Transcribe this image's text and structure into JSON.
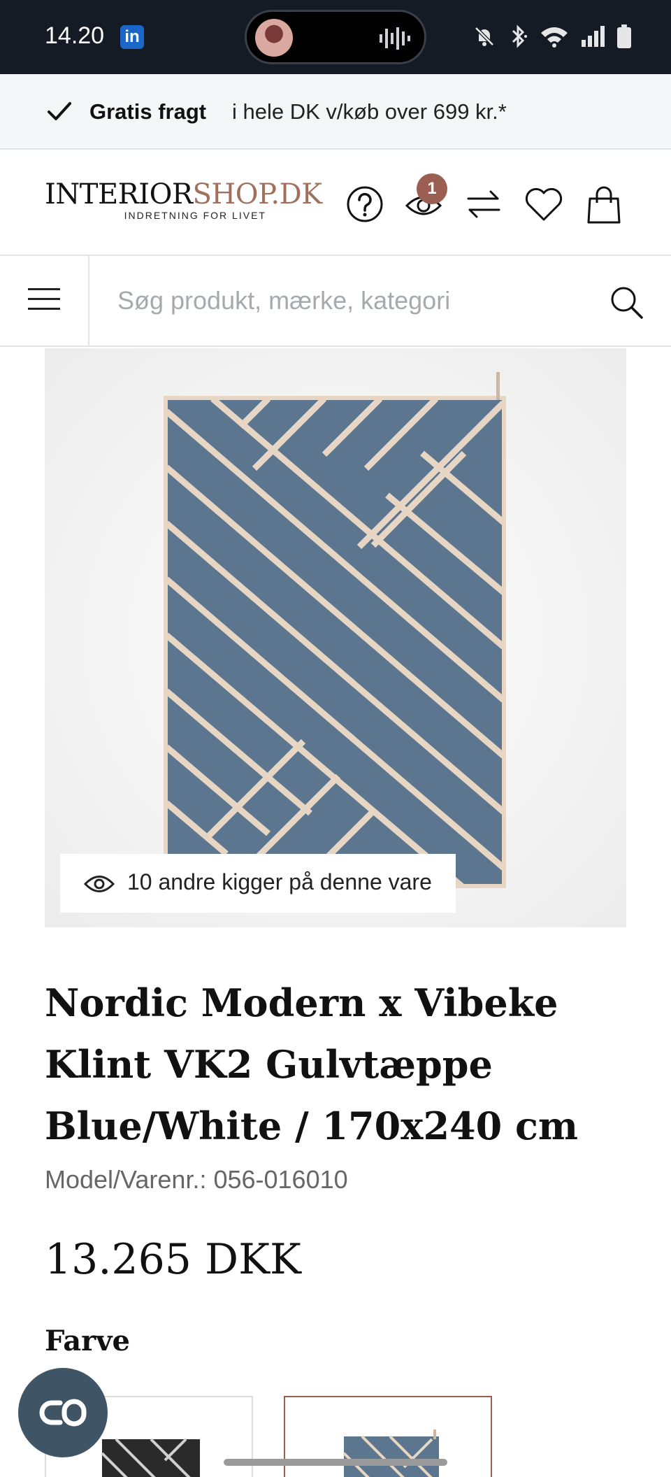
{
  "status_bar": {
    "time": "14.20",
    "app_badge": "in",
    "icons": [
      "mute-icon",
      "bluetooth-icon",
      "wifi-icon",
      "signal-icon",
      "battery-icon"
    ]
  },
  "shipping_banner": {
    "icon": "checkmark-icon",
    "strong": "Gratis fragt",
    "text": "i hele DK v/køb over 699 kr.*"
  },
  "header": {
    "logo_part1": "INTERIOR",
    "logo_part2": "SHOP.DK",
    "logo_tagline": "INDRETNING FOR LIVET",
    "recently_viewed_count": "1",
    "icons": [
      "help-icon",
      "recently-viewed-icon",
      "compare-icon",
      "wishlist-heart-icon",
      "cart-bag-icon"
    ],
    "colors": {
      "accent": "#9a5f52",
      "logo_accent": "#a0705c"
    }
  },
  "search": {
    "placeholder": "Søg produkt, mærke, kategori",
    "value": ""
  },
  "product": {
    "viewers_text": "10 andre kigger på denne vare",
    "title": "Nordic Modern x Vibeke Klint VK2 Gulvtæppe Blue/White / 170x240 cm",
    "model": "Model/Varenr.: 056-016010",
    "price": "13.265 DKK",
    "color_label": "Farve",
    "swatches": [
      {
        "color": "#2a2a2a",
        "selected": false
      },
      {
        "color": "#5c7690",
        "selected": true
      }
    ],
    "rug_colors": {
      "field": "#5c7690",
      "stripe": "#e8d6c4"
    }
  },
  "chat": {
    "icon": "chat-glasses-icon"
  }
}
